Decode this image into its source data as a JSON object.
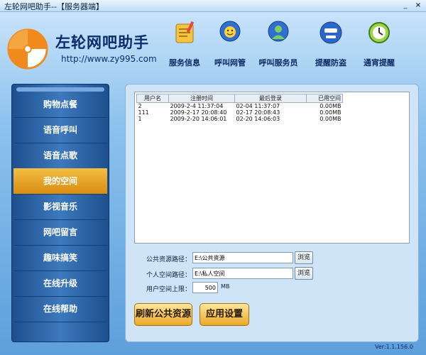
{
  "window": {
    "title": "左轮网吧助手--【服务器端】",
    "min_symbol": "_",
    "close_symbol": "×"
  },
  "brand": {
    "name": "左轮网吧助手",
    "url": "http://www.zy995.com"
  },
  "topnav": [
    {
      "label": "服务信息",
      "icon": "notepad-icon"
    },
    {
      "label": "呼叫网管",
      "icon": "smiley-bubble-icon"
    },
    {
      "label": "呼叫服务员",
      "icon": "user-bubble-icon"
    },
    {
      "label": "提醒防盗",
      "icon": "guard-face-icon"
    },
    {
      "label": "通宵提醒",
      "icon": "clock-icon"
    }
  ],
  "sidebar": {
    "items": [
      {
        "label": "购物点餐"
      },
      {
        "label": "语音呼叫"
      },
      {
        "label": "语音点歌"
      },
      {
        "label": "我的空间"
      },
      {
        "label": "影视音乐"
      },
      {
        "label": "网吧留言"
      },
      {
        "label": "趣味搞笑"
      },
      {
        "label": "在线升级"
      },
      {
        "label": "在线帮助"
      }
    ],
    "active_index": 3
  },
  "table": {
    "headers": [
      "用户名",
      "注册时间",
      "最后登录",
      "已用空间"
    ],
    "rows": [
      [
        "2",
        "2009-2-4 11:37:04",
        "02-04 11:37:07",
        "0.00MB"
      ],
      [
        "111",
        "2009-2-17 20:08:40",
        "02-17 20:08:43",
        "0.00MB"
      ],
      [
        "1",
        "2009-2-20 14:06:01",
        "02-20 14:06:03",
        "0.00MB"
      ]
    ]
  },
  "form": {
    "public_path_label": "公共资源路径：",
    "public_path_value": "E:\\公共资源",
    "private_path_label": "个人空间路径：",
    "private_path_value": "E:\\私人空间",
    "limit_label": "用户空间上限：",
    "limit_value": "500",
    "limit_unit": "MB",
    "browse_label": "浏览"
  },
  "actions": {
    "refresh_label": "刷新公共资源",
    "apply_label": "应用设置"
  },
  "version": "Ver:1.1.156.0",
  "colors": {
    "active_item": "#e9a21f",
    "sidebar": "#2a62a5",
    "panel": "#cfe4f6"
  }
}
